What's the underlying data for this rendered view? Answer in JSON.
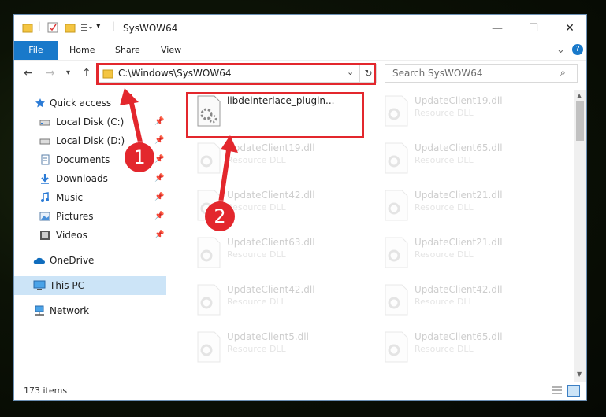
{
  "window": {
    "title": "SysWOW64",
    "minimize": "—",
    "maximize": "☐",
    "close": "✕"
  },
  "ribbon": {
    "tabs": [
      "File",
      "Home",
      "Share",
      "View"
    ],
    "collapse": "⌄",
    "help": "?"
  },
  "address": {
    "path": "C:\\Windows\\SysWOW64",
    "search_placeholder": "Search SysWOW64"
  },
  "sidebar": {
    "items": [
      {
        "label": "Quick access",
        "icon": "star-icon"
      },
      {
        "label": "Local Disk (C:)",
        "icon": "drive-icon"
      },
      {
        "label": "Local Disk (D:)",
        "icon": "drive-icon"
      },
      {
        "label": "Documents",
        "icon": "documents-icon"
      },
      {
        "label": "Downloads",
        "icon": "download-icon"
      },
      {
        "label": "Music",
        "icon": "music-icon"
      },
      {
        "label": "Pictures",
        "icon": "pictures-icon"
      },
      {
        "label": "Videos",
        "icon": "videos-icon"
      },
      {
        "label": "OneDrive",
        "icon": "cloud-icon"
      },
      {
        "label": "This PC",
        "icon": "computer-icon"
      },
      {
        "label": "Network",
        "icon": "network-icon"
      }
    ]
  },
  "files": [
    {
      "name": "libdeinterlace_plugin...",
      "type": ""
    },
    {
      "name": "UpdateClient19.dll",
      "type": "Resource DLL"
    },
    {
      "name": "UpdateClient19.dll",
      "type": "Resource DLL"
    },
    {
      "name": "UpdateClient65.dll",
      "type": "Resource DLL"
    },
    {
      "name": "UpdateClient42.dll",
      "type": "Resource DLL"
    },
    {
      "name": "UpdateClient21.dll",
      "type": "Resource DLL"
    },
    {
      "name": "UpdateClient63.dll",
      "type": "Resource DLL"
    },
    {
      "name": "UpdateClient21.dll",
      "type": "Resource DLL"
    },
    {
      "name": "UpdateClient42.dll",
      "type": "Resource DLL"
    },
    {
      "name": "UpdateClient42.dll",
      "type": "Resource DLL"
    },
    {
      "name": "UpdateClient5.dll",
      "type": "Resource DLL"
    },
    {
      "name": "UpdateClient65.dll",
      "type": "Resource DLL"
    }
  ],
  "status": {
    "count": "173 items"
  },
  "annotations": {
    "step1": "1",
    "step2": "2",
    "highlight_color": "#e3272d"
  },
  "colors": {
    "accent": "#1979ca",
    "selected": "#cce4f7"
  }
}
